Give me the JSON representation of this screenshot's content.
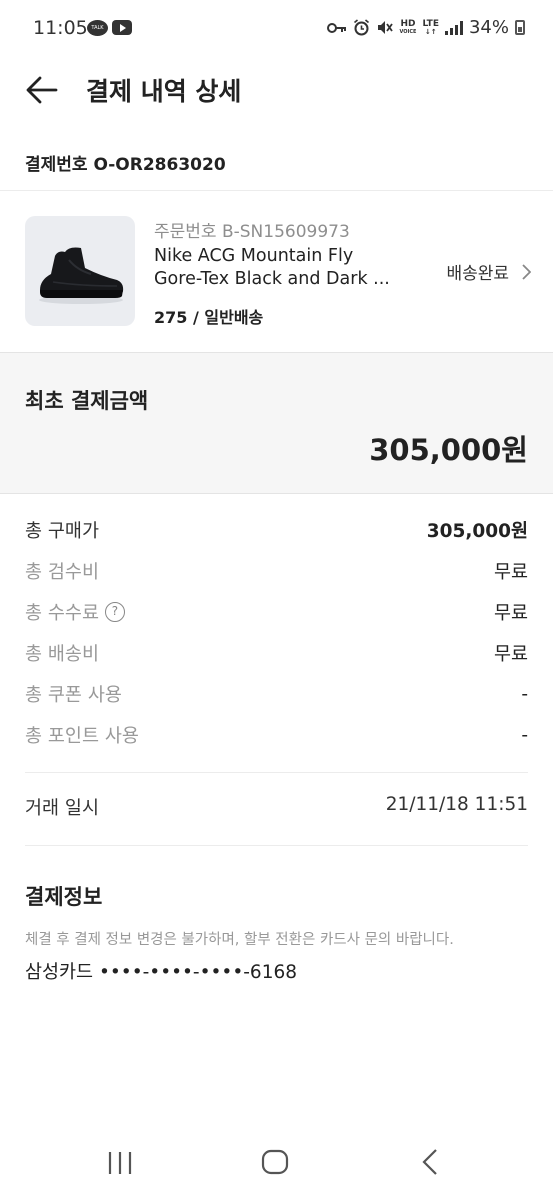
{
  "status_bar": {
    "time": "11:05",
    "talk_badge": "TALK",
    "hd_label": "HD",
    "voice_label": "VOICE",
    "lte_label": "LTE",
    "battery": "34%"
  },
  "header": {
    "title": "결제 내역 상세"
  },
  "order": {
    "number": "결제번호 O-OR2863020"
  },
  "product": {
    "sub_order_number": "주문번호 B-SN15609973",
    "name_line1": "Nike ACG Mountain Fly",
    "name_line2": "Gore-Tex Black and Dark ...",
    "size": "275",
    "separator": " / ",
    "shipping_type": "일반배송",
    "status": "배송완료"
  },
  "initial_amount": {
    "label": "최초 결제금액",
    "value": "305,000원"
  },
  "breakdown": [
    {
      "label": "총 구매가",
      "value": "305,000원"
    },
    {
      "label": "총 검수비",
      "value": "무료"
    },
    {
      "label": "총 수수료",
      "value": "무료"
    },
    {
      "label": "총 배송비",
      "value": "무료"
    },
    {
      "label": "총 쿠폰 사용",
      "value": "-"
    },
    {
      "label": "총 포인트 사용",
      "value": "-"
    }
  ],
  "trade": {
    "label": "거래 일시",
    "value": "21/11/18 11:51"
  },
  "payment": {
    "title": "결제정보",
    "note": "체결 후 결제 정보 변경은 불가하며, 할부 전환은 카드사 문의 바랍니다.",
    "card": "삼성카드 ••••-••••-••••-6168"
  },
  "icons": {
    "back": "arrow-left-icon",
    "chevron": "chevron-right-icon",
    "help": "question-circle-icon",
    "nav_recent": "recent-apps-icon",
    "nav_home": "home-icon",
    "nav_back": "back-icon"
  }
}
